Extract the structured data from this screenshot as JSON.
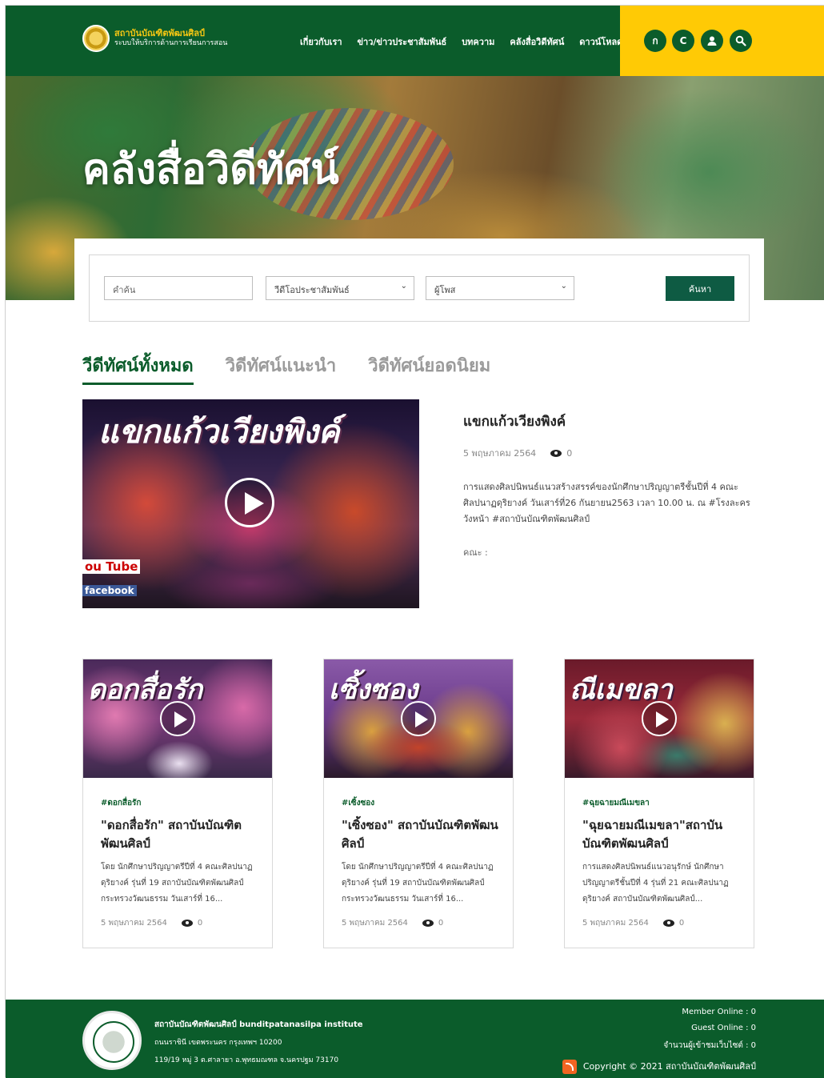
{
  "header": {
    "logo_title": "สถาบันบัณฑิตพัฒนศิลป์",
    "logo_subtitle": "ระบบให้บริการด้านการเรียนการสอน",
    "nav": [
      "เกี่ยวกับเรา",
      "ข่าว/ข่าวประชาสัมพันธ์",
      "บทความ",
      "คลังสื่อวิดีทัศน์",
      "ดาวน์โหลด"
    ],
    "icons": [
      {
        "label": "ก",
        "name": "font-thai-icon"
      },
      {
        "label": "C",
        "name": "contrast-icon"
      },
      {
        "label": "👤",
        "name": "user-icon"
      },
      {
        "label": "⚲",
        "name": "search-icon"
      }
    ]
  },
  "hero": {
    "title": "คลังสื่อวิดีทัศน์"
  },
  "search": {
    "keyword_placeholder": "คำค้น",
    "category_value": "วีดีโอประชาสัมพันธ์",
    "poster_value": "ผู้โพส",
    "button_label": "ค้นหา"
  },
  "tabs": [
    "วีดีทัศน์ทั้งหมด",
    "วิดีทัศน์แนะนำ",
    "วิดีทัศน์ยอดนิยม"
  ],
  "featured": {
    "thumb_text": "แขกแก้วเวียงพิงค์",
    "yt_text": "ou Tube",
    "fb_text": "facebook",
    "title": "แขกแก้วเวียงพิงค์",
    "date": "5 พฤษภาคม 2564",
    "views": "0",
    "description": "การแสดงศิลปนิพนธ์แนวสร้างสรรค์ของนักศึกษาปริญญาตรีชั้นปีที่ 4 คณะศิลปนาฏดุริยางค์ วันเสาร์ที่26 กันยายน2563 เวลา 10.00 น. ณ #โรงละครวังหน้า #สถาบันบัณฑิตพัฒนศิลป์",
    "faculty": "คณะ :"
  },
  "cards": [
    {
      "thumb_text": "ดอกสื่อรัก",
      "tag": "#ดอกสื่อรัก",
      "title": "\"ดอกสื่อรัก\" สถาบันบัณฑิตพัฒนศิลป์",
      "description": "โดย นักศึกษาปริญญาตรีปีที่ 4 คณะศิลปนาฏดุริยางค์ รุ่นที่ 19 สถาบันบัณฑิตพัฒนศิลป์ กระทรวงวัฒนธรรม วันเสาร์ที่ 16...",
      "date": "5 พฤษภาคม 2564",
      "views": "0"
    },
    {
      "thumb_text": "เซิ้งซอง",
      "tag": "#เซิ้งซอง",
      "title": "\"เซิ้งซอง\" สถาบันบัณฑิตพัฒนศิลป์",
      "description": "โดย นักศึกษาปริญญาตรีปีที่ 4 คณะศิลปนาฏดุริยางค์ รุ่นที่ 19 สถาบันบัณฑิตพัฒนศิลป์ กระทรวงวัฒนธรรม วันเสาร์ที่ 16...",
      "date": "5 พฤษภาคม 2564",
      "views": "0"
    },
    {
      "thumb_text": "ณีเมขลา",
      "tag": "#ฉุยฉายมณีเมขลา",
      "title": "\"ฉุยฉายมณีเมขลา\"สถาบันบัณฑิตพัฒนศิลป์",
      "description": "การแสดงศิลปนิพนธ์แนวอนุรักษ์ นักศึกษาปริญญาตรีชั้นปีที่ 4 รุ่นที่ 21 คณะศิลปนาฏดุริยางค์ สถาบันบัณฑิตพัฒนศิลป์...",
      "date": "5 พฤษภาคม 2564",
      "views": "0"
    }
  ],
  "footer": {
    "org": "สถาบันบัณฑิตพัฒนศิลป์ bunditpatanasilpa institute",
    "addr1": "ถนนราชินี เขตพระนคร กรุงเทพฯ 10200",
    "addr2": "119/19 หมู่ 3 ต.ศาลายา อ.พุทธมณฑล จ.นครปฐม 73170",
    "member_online": "Member Online : 0",
    "guest_online": "Guest Online : 0",
    "visitors": "จำนวนผู้เข้าชมเว็บไซต์ : 0",
    "copyright": "Copyright © 2021 สถาบันบัณฑิตพัฒนศิลป์"
  },
  "colors": {
    "primary_green": "#0b5c2b",
    "accent_yellow": "#ffca05",
    "button_green": "#0e5b43"
  }
}
